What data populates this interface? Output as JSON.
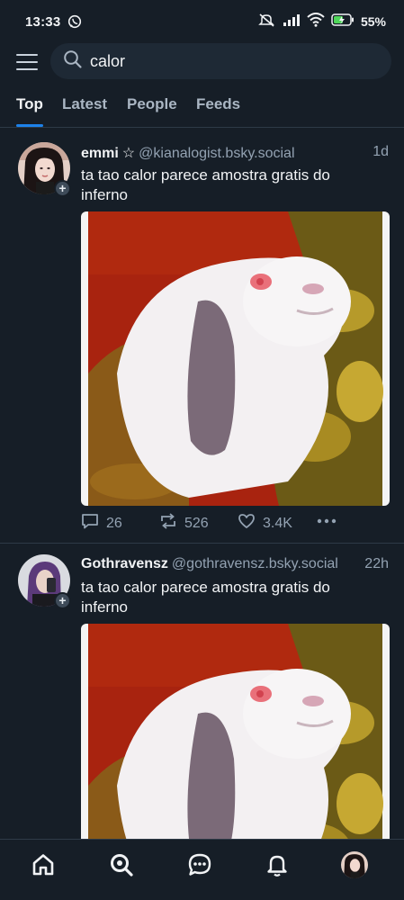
{
  "status": {
    "time": "13:33",
    "battery_pct": "55%"
  },
  "search": {
    "query": "calor"
  },
  "tabs": [
    {
      "label": "Top"
    },
    {
      "label": "Latest"
    },
    {
      "label": "People"
    },
    {
      "label": "Feeds"
    }
  ],
  "posts": [
    {
      "name": "emmi",
      "badge": "☆",
      "handle": "@kianalogist.bsky.social",
      "time": "1d",
      "text": "ta tao calor parece amostra gratis do inferno",
      "replies": "26",
      "reposts": "526",
      "likes": "3.4K"
    },
    {
      "name": "Gothravensz",
      "handle": "@gothravensz.bsky.social",
      "time": "22h",
      "text": "ta tao calor parece amostra gratis do inferno"
    }
  ],
  "colors": {
    "background": "#161e27",
    "accent": "#1d82ea",
    "muted_text": "#93a2b2"
  },
  "icons": {
    "status": [
      "whatsapp-icon",
      "mute-icon",
      "signal-icon",
      "wifi-icon",
      "battery-icon"
    ],
    "nav": [
      "home-icon",
      "search-icon",
      "chat-icon",
      "bell-icon",
      "profile-avatar"
    ]
  }
}
